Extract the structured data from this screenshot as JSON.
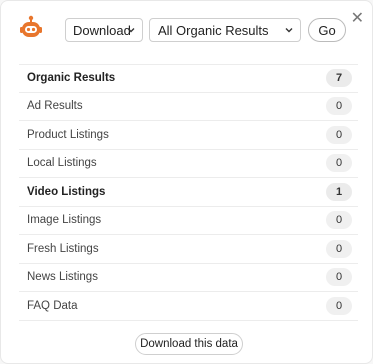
{
  "toolbar": {
    "download_label": "Download",
    "filter_label": "All Organic Results",
    "go_label": "Go",
    "close_glyph": "✕"
  },
  "results": [
    {
      "label": "Organic Results",
      "count": "7",
      "bold": true
    },
    {
      "label": "Ad Results",
      "count": "0",
      "bold": false
    },
    {
      "label": "Product Listings",
      "count": "0",
      "bold": false
    },
    {
      "label": "Local Listings",
      "count": "0",
      "bold": false
    },
    {
      "label": "Video Listings",
      "count": "1",
      "bold": true
    },
    {
      "label": "Image Listings",
      "count": "0",
      "bold": false
    },
    {
      "label": "Fresh Listings",
      "count": "0",
      "bold": false
    },
    {
      "label": "News Listings",
      "count": "0",
      "bold": false
    },
    {
      "label": "FAQ Data",
      "count": "0",
      "bold": false
    }
  ],
  "footer": {
    "download_data_label": "Download this data"
  },
  "colors": {
    "logo_orange": "#e8762d"
  },
  "icons": {
    "logo": "robot-logo-icon",
    "close": "close-icon",
    "dropdown": "chevron-down-icon"
  }
}
